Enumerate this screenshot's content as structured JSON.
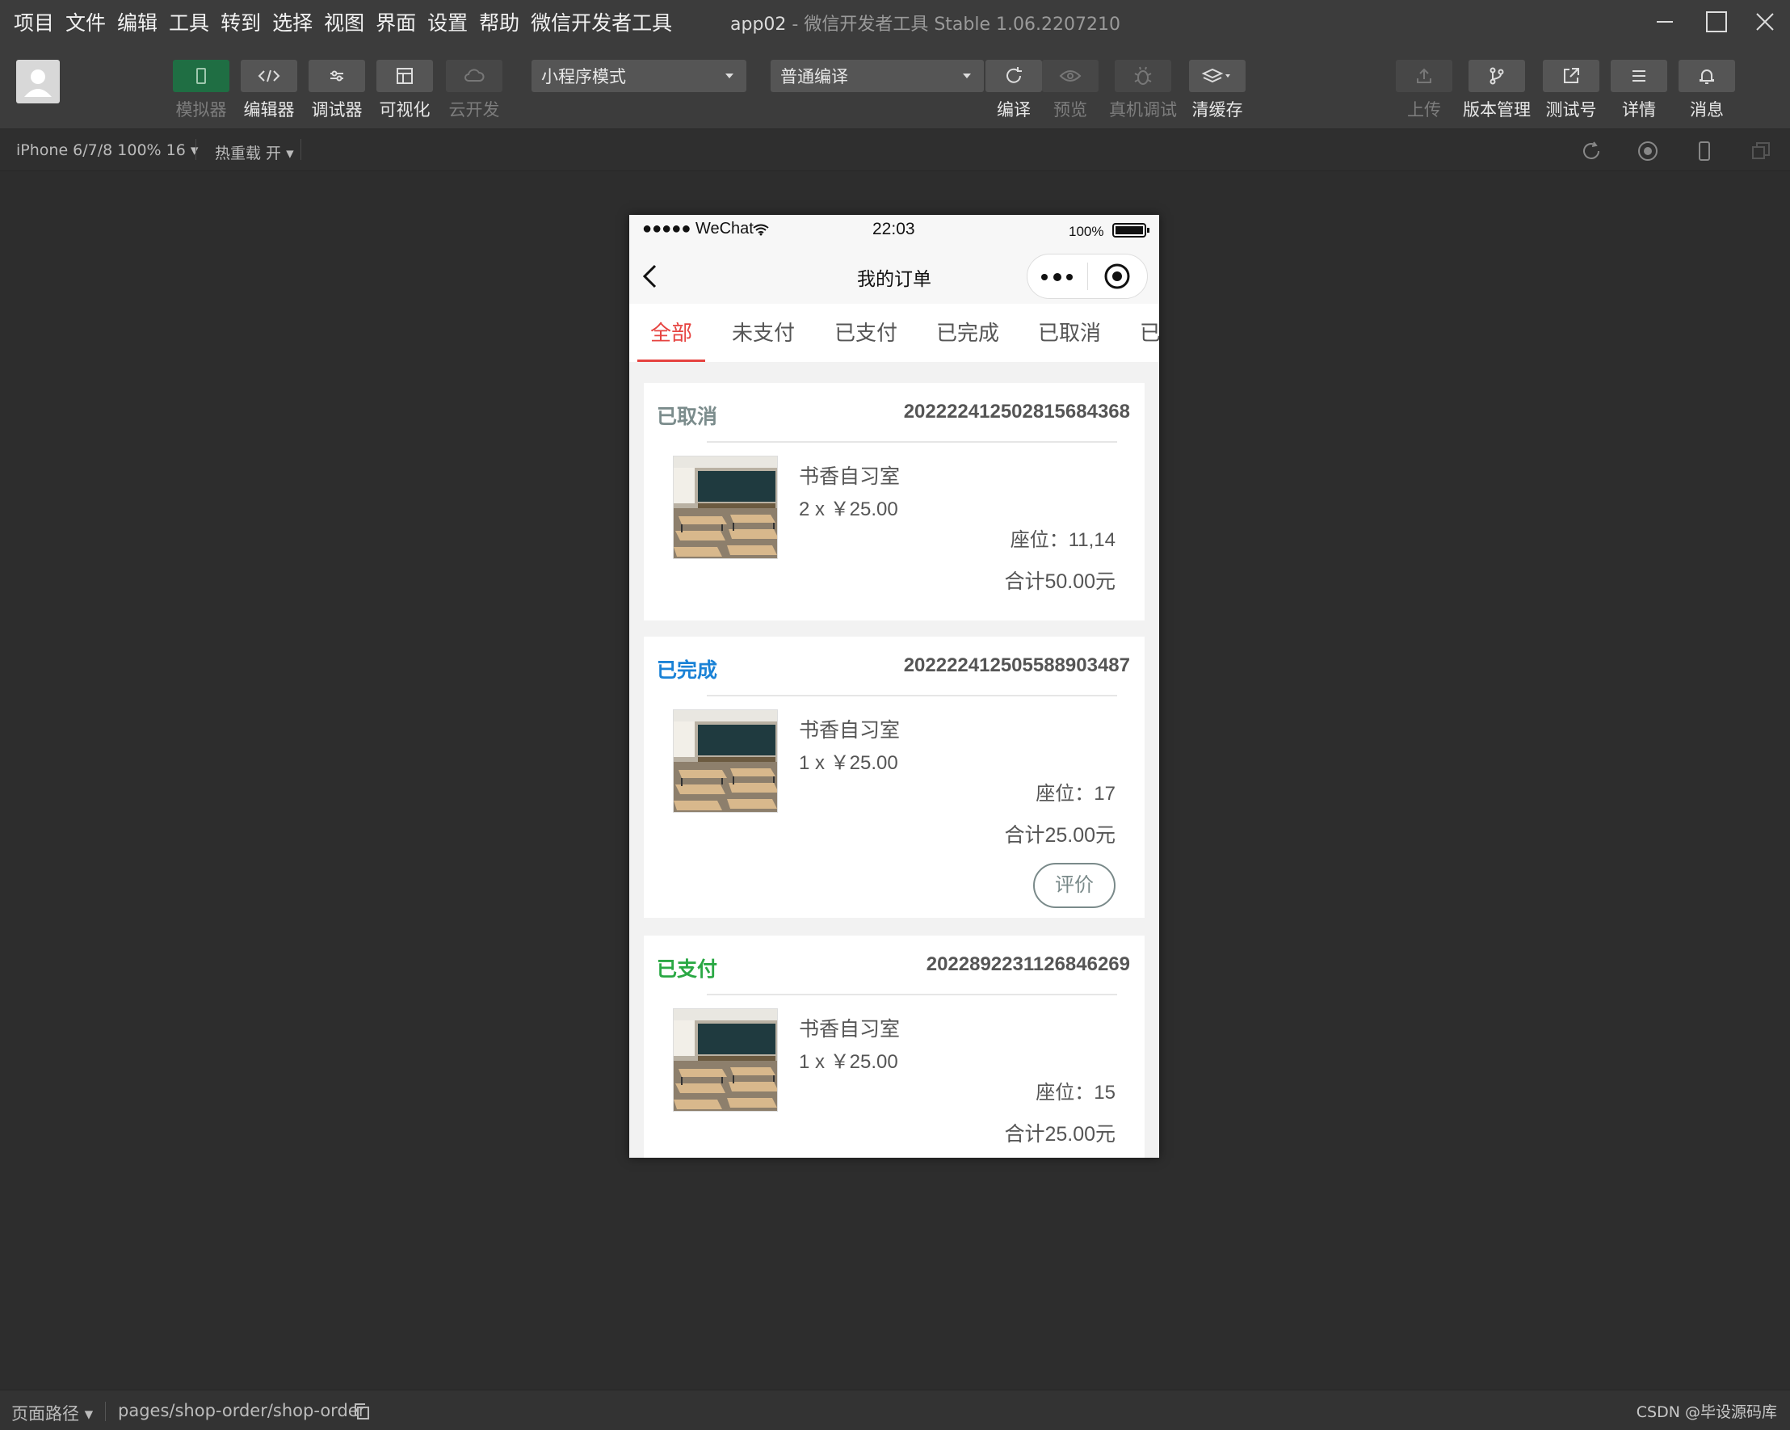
{
  "menu": [
    "项目",
    "文件",
    "编辑",
    "工具",
    "转到",
    "选择",
    "视图",
    "界面",
    "设置",
    "帮助",
    "微信开发者工具"
  ],
  "window": {
    "project": "app02",
    "sep": " - ",
    "app_title": "微信开发者工具 Stable 1.06.2207210"
  },
  "toolbar": {
    "left": [
      "模拟器",
      "编辑器",
      "调试器",
      "可视化",
      "云开发"
    ],
    "mode_select": "小程序模式",
    "compile_select": "普通编译",
    "mid": [
      "编译",
      "预览",
      "真机调试",
      "清缓存"
    ],
    "right": [
      "上传",
      "版本管理",
      "测试号",
      "详情",
      "消息"
    ]
  },
  "subbar": {
    "device": "iPhone 6/7/8 100% 16 ▾",
    "hotreload": "热重载 开 ▾"
  },
  "statusbar": {
    "path_label": "页面路径 ▾",
    "path": "pages/shop-order/shop-order",
    "watermark": "CSDN @毕设源码库"
  },
  "phone": {
    "signal": "●●●●● WeChat",
    "time": "22:03",
    "battery": "100%",
    "title": "我的订单",
    "tabs": [
      "全部",
      "未支付",
      "已支付",
      "已完成",
      "已取消",
      "已"
    ],
    "orders": [
      {
        "status": "已取消",
        "status_color": "#7b8c8c",
        "order_no": "20222241250281568436８",
        "name": "书香自习室",
        "qty": "2 x ￥25.00",
        "seat": "座位：11,14",
        "total": "合计50.00元",
        "action": ""
      },
      {
        "status": "已完成",
        "status_color": "#1a82d6",
        "order_no": "20222241250558890348７",
        "name": "书香自习室",
        "qty": "1 x ￥25.00",
        "seat": "座位：17",
        "total": "合计25.00元",
        "action": "评价"
      },
      {
        "status": "已支付",
        "status_color": "#2aa844",
        "order_no": "2022892231126846269",
        "name": "书香自习室",
        "qty": "1 x ￥25.00",
        "seat": "座位：15",
        "total": "合计25.00元",
        "action": ""
      }
    ]
  }
}
